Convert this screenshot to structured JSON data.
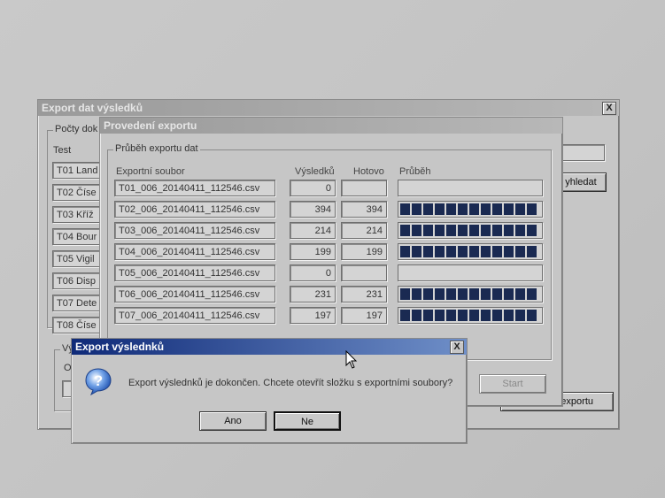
{
  "back_window": {
    "title": "Export dat výsledků",
    "close": "X",
    "group_label": "Počty dok",
    "column_label": "Test",
    "tests": [
      "T01 Land",
      "T02 Číse",
      "T03 Kříž",
      "T04 Bour",
      "T05 Vigil",
      "T06 Disp",
      "T07 Dete",
      "T08 Číse"
    ],
    "search_button": "yhledat",
    "export_button": "exportu",
    "bottom_group_label": "Vý",
    "bottom_group_text": "O"
  },
  "progress_window": {
    "title": "Provedení exportu",
    "group_label": "Průběh exportu dat",
    "columns": {
      "file": "Exportní soubor",
      "results": "Výsledků",
      "done": "Hotovo",
      "progress": "Průběh"
    },
    "rows": [
      {
        "file": "T01_006_20140411_112546.csv",
        "results": "0",
        "done": "",
        "progress": 0
      },
      {
        "file": "T02_006_20140411_112546.csv",
        "results": "394",
        "done": "394",
        "progress": 1
      },
      {
        "file": "T03_006_20140411_112546.csv",
        "results": "214",
        "done": "214",
        "progress": 1
      },
      {
        "file": "T04_006_20140411_112546.csv",
        "results": "199",
        "done": "199",
        "progress": 1
      },
      {
        "file": "T05_006_20140411_112546.csv",
        "results": "0",
        "done": "",
        "progress": 0
      },
      {
        "file": "T06_006_20140411_112546.csv",
        "results": "231",
        "done": "231",
        "progress": 1
      },
      {
        "file": "T07_006_20140411_112546.csv",
        "results": "197",
        "done": "197",
        "progress": 1
      }
    ],
    "start_button": "Start"
  },
  "dialog": {
    "title": "Export výslednků",
    "close": "X",
    "icon": "question-icon",
    "message": "Export výslednků je dokončen. Chcete otevřít složku s exportními soubory?",
    "yes_button": "Ano",
    "no_button": "Ne"
  },
  "colors": {
    "titlebar_active": "#0f2a78",
    "progress_fill": "#1a2a52"
  }
}
